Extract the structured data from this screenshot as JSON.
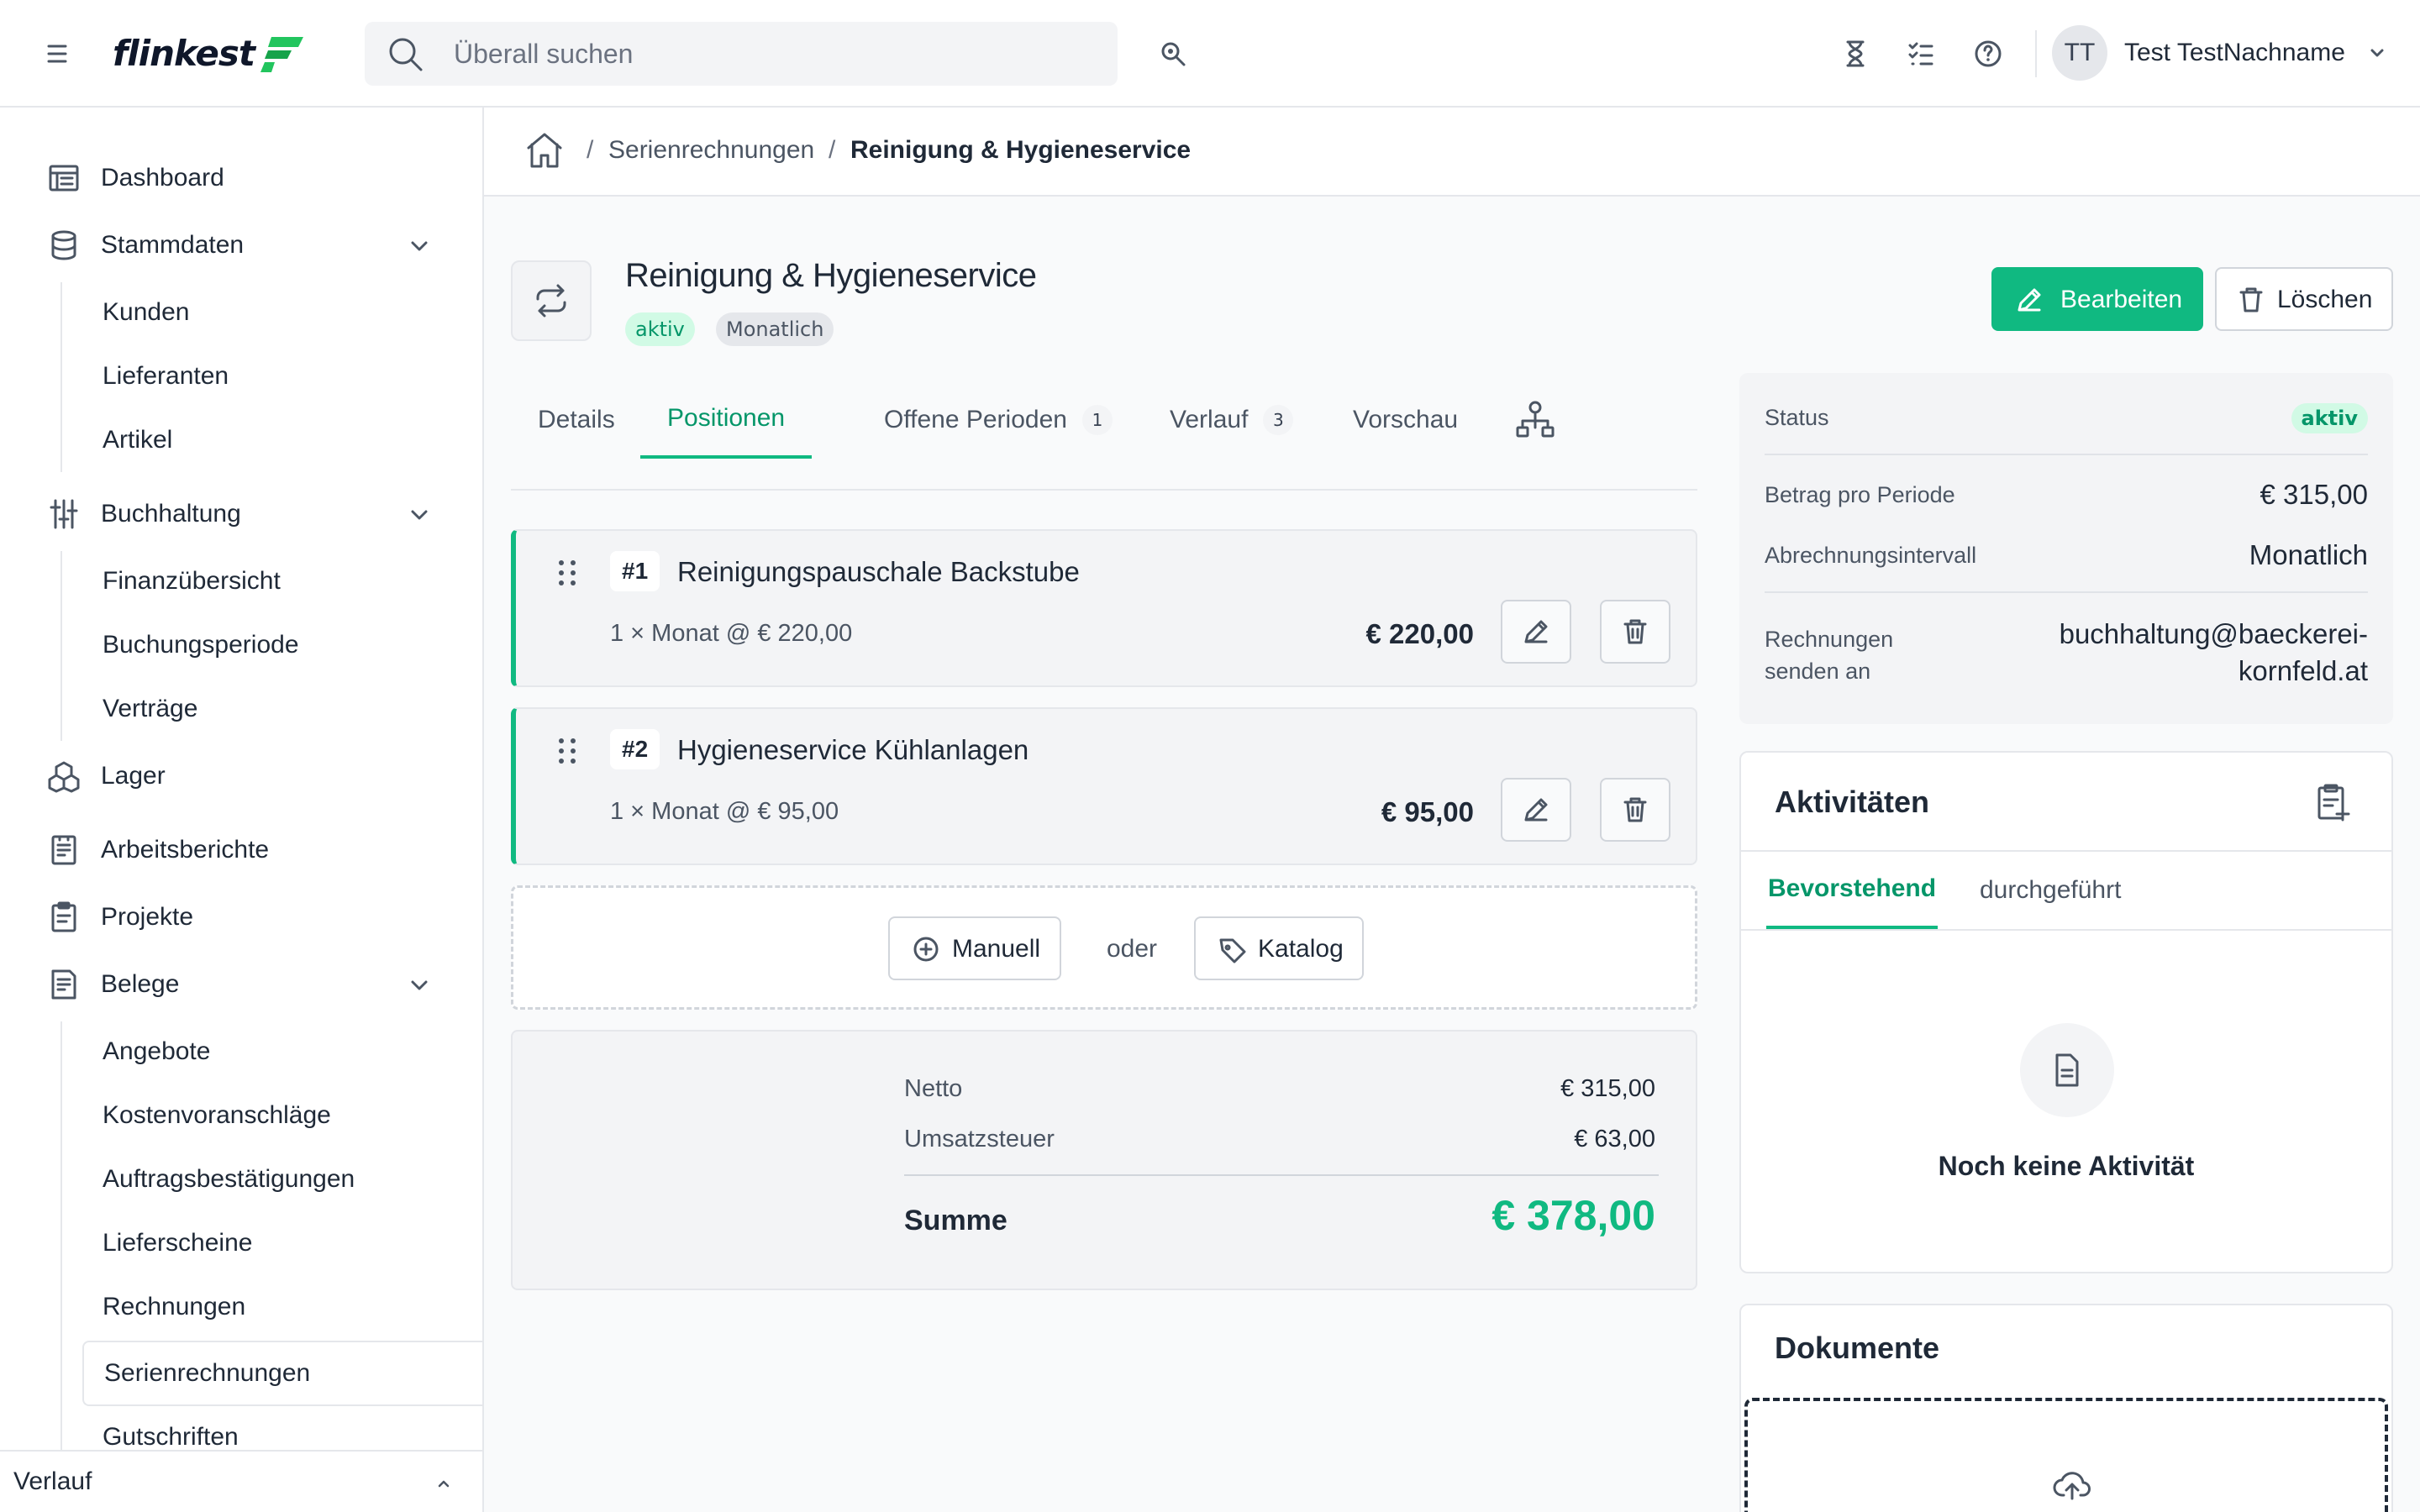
{
  "brand": {
    "logo_text": "flinkest",
    "accent": "#10b981",
    "accent_dark": "#059669"
  },
  "search": {
    "placeholder": "Überall suchen"
  },
  "topbar": {
    "icons": [
      "hamburger-icon",
      "search-icon",
      "hourglass-icon",
      "checklist-icon",
      "help-icon",
      "chevron-down-icon"
    ],
    "user": {
      "initials": "TT",
      "name": "Test TestNachname"
    }
  },
  "sidebar": {
    "items": [
      {
        "label": "Dashboard",
        "icon": "dashboard-icon"
      },
      {
        "label": "Stammdaten",
        "icon": "database-icon",
        "expanded": true,
        "children": [
          "Kunden",
          "Lieferanten",
          "Artikel"
        ]
      },
      {
        "label": "Buchhaltung",
        "icon": "sliders-icon",
        "expanded": true,
        "children": [
          "Finanzübersicht",
          "Buchungsperiode",
          "Verträge"
        ]
      },
      {
        "label": "Lager",
        "icon": "boxes-icon"
      },
      {
        "label": "Arbeitsberichte",
        "icon": "report-icon"
      },
      {
        "label": "Projekte",
        "icon": "clipboard-icon"
      },
      {
        "label": "Belege",
        "icon": "receipt-icon",
        "expanded": true,
        "children": [
          "Angebote",
          "Kostenvoranschläge",
          "Auftragsbestätigungen",
          "Lieferscheine",
          "Rechnungen",
          "Serienrechnungen",
          "Gutschriften"
        ]
      }
    ],
    "active_child": "Serienrechnungen",
    "footer": "Verlauf"
  },
  "breadcrumb": {
    "parent": "Serienrechnungen",
    "current": "Reinigung & Hygieneservice",
    "separator": "/"
  },
  "header": {
    "title": "Reinigung & Hygieneservice",
    "badges": [
      "aktiv",
      "Monatlich"
    ],
    "edit_label": "Bearbeiten",
    "delete_label": "Löschen"
  },
  "tabs": [
    {
      "label": "Details"
    },
    {
      "label": "Positionen",
      "active": true
    },
    {
      "label": "Offene Perioden",
      "count": "1"
    },
    {
      "label": "Verlauf",
      "count": "3"
    },
    {
      "label": "Vorschau"
    }
  ],
  "positions": [
    {
      "num": "#1",
      "name": "Reinigungspauschale Backstube",
      "detail": "1 × Monat @ € 220,00",
      "amount": "€ 220,00"
    },
    {
      "num": "#2",
      "name": "Hygieneservice Kühlanlagen",
      "detail": "1 × Monat @ € 95,00",
      "amount": "€ 95,00"
    }
  ],
  "add": {
    "manual_label": "Manuell",
    "or_label": "oder",
    "catalog_label": "Katalog"
  },
  "totals": {
    "net_label": "Netto",
    "net_value": "€ 315,00",
    "tax_label": "Umsatzsteuer",
    "tax_value": "€ 63,00",
    "sum_label": "Summe",
    "sum_value": "€ 378,00"
  },
  "status_card": {
    "status_label": "Status",
    "status_value": "aktiv",
    "amount_label": "Betrag pro Periode",
    "amount_value": "€ 315,00",
    "interval_label": "Abrechnungsintervall",
    "interval_value": "Monatlich",
    "send_label_1": "Rechnungen",
    "send_label_2": "senden an",
    "send_value_1": "buchhaltung@baeckerei-",
    "send_value_2": "kornfeld.at"
  },
  "activities": {
    "title": "Aktivitäten",
    "tabs": [
      "Bevorstehend",
      "durchgeführt"
    ],
    "empty_text": "Noch keine Aktivität"
  },
  "documents": {
    "title": "Dokumente"
  }
}
